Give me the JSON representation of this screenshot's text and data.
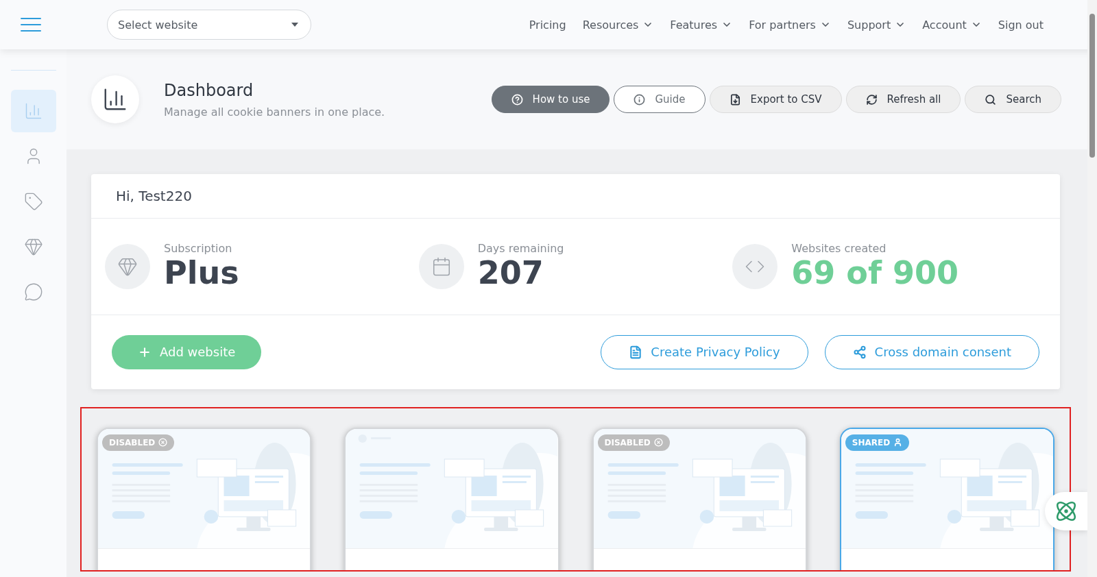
{
  "topbar": {
    "site_select": {
      "placeholder": "Select website"
    },
    "nav": [
      {
        "label": "Pricing",
        "has_menu": false
      },
      {
        "label": "Resources",
        "has_menu": true
      },
      {
        "label": "Features",
        "has_menu": true
      },
      {
        "label": "For partners",
        "has_menu": true
      },
      {
        "label": "Support",
        "has_menu": true
      },
      {
        "label": "Account",
        "has_menu": true
      },
      {
        "label": "Sign out",
        "has_menu": false
      }
    ]
  },
  "sidebar": {
    "items": [
      {
        "selected": true
      },
      {
        "selected": false
      },
      {
        "selected": false
      },
      {
        "selected": false
      },
      {
        "selected": false
      }
    ]
  },
  "page_header": {
    "title": "Dashboard",
    "subtitle": "Manage all cookie banners in one place.",
    "buttons": [
      {
        "label": "How to use",
        "kind": "dark"
      },
      {
        "label": "Guide",
        "kind": "outline"
      },
      {
        "label": "Export to CSV",
        "kind": "grey"
      },
      {
        "label": "Refresh all",
        "kind": "grey"
      },
      {
        "label": "Search",
        "kind": "grey"
      }
    ]
  },
  "summary": {
    "greeting": "Hi, Test220",
    "stats": [
      {
        "label": "Subscription",
        "value": "Plus",
        "color": "#3d4450"
      },
      {
        "label": "Days remaining",
        "value": "207",
        "color": "#3d4450"
      },
      {
        "label": "Websites created",
        "value": "69 of 900",
        "color": "#6fcf97"
      }
    ],
    "actions": [
      {
        "label": "Add website",
        "kind": "primary"
      },
      {
        "label": "Create Privacy Policy",
        "kind": "outline"
      },
      {
        "label": "Cross domain consent",
        "kind": "outline"
      }
    ]
  },
  "websites": [
    {
      "badge": {
        "kind": "disabled",
        "label": "DISABLED"
      }
    },
    {
      "badge": {
        "kind": "none"
      }
    },
    {
      "badge": {
        "kind": "disabled",
        "label": "DISABLED"
      }
    },
    {
      "badge": {
        "kind": "shared",
        "label": "SHARED"
      }
    }
  ]
}
